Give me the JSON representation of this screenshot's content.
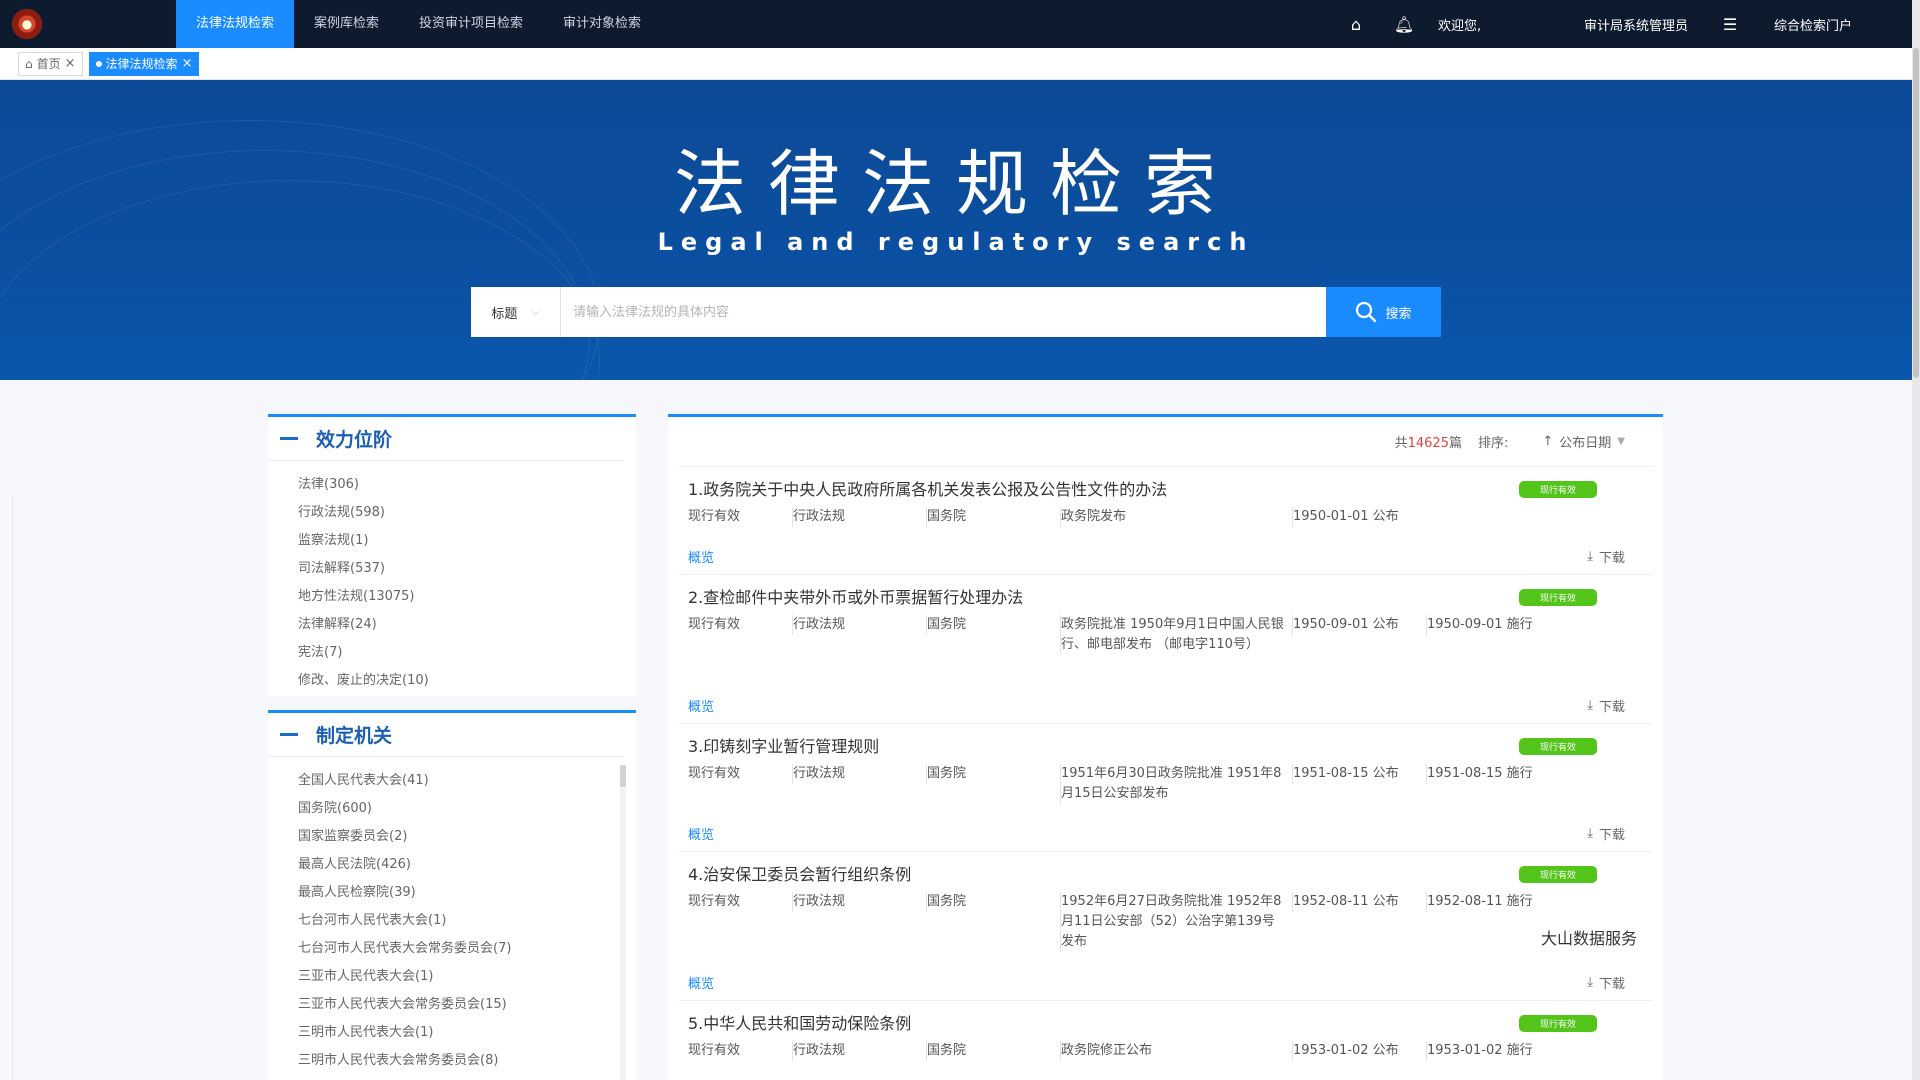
{
  "topbar": {
    "nav": [
      "法律法规检索",
      "案例库检索",
      "投资审计项目检索",
      "审计对象检索"
    ],
    "welcome": "欢迎您,",
    "user": "审计局系统管理员",
    "portal": "综合检索门户"
  },
  "tags": {
    "home": "首页",
    "current": "法律法规检索"
  },
  "banner": {
    "title": "法律法规检索",
    "subtitle": "Legal and regulatory search"
  },
  "search": {
    "field": "标题",
    "placeholder": "请输入法律法规的具体内容",
    "button": "搜索"
  },
  "panel_level": {
    "title": "效力位阶",
    "items": [
      "法律(306)",
      "行政法规(598)",
      "监察法规(1)",
      "司法解释(537)",
      "地方性法规(13075)",
      "法律解释(24)",
      "宪法(7)",
      "修改、废止的决定(10)"
    ]
  },
  "panel_org": {
    "title": "制定机关",
    "items": [
      "全国人民代表大会(41)",
      "国务院(600)",
      "国家监察委员会(2)",
      "最高人民法院(426)",
      "最高人民检察院(39)",
      "七台河市人民代表大会(1)",
      "七台河市人民代表大会常务委员会(7)",
      "三亚市人民代表大会(1)",
      "三亚市人民代表大会常务委员会(15)",
      "三明市人民代表大会(1)",
      "三明市人民代表大会常务委员会(8)"
    ]
  },
  "results": {
    "total_prefix": "共",
    "total": "14625",
    "total_suffix": "篇",
    "sort_label": "排序:",
    "sort_value": "公布日期",
    "overview": "概览",
    "download": "下载",
    "watermark": "大山数据服务",
    "items": [
      {
        "title": "1.政务院关于中央人民政府所属各机关发表公报及公告性文件的办法",
        "badge": "现行有效",
        "status": "现行有效",
        "level": "行政法规",
        "org": "国务院",
        "note": "政务院发布",
        "published": "1950-01-01 公布",
        "effective": ""
      },
      {
        "title": "2.查检邮件中夹带外币或外币票据暂行处理办法",
        "badge": "现行有效",
        "status": "现行有效",
        "level": "行政法规",
        "org": "国务院",
        "note": "政务院批准 1950年9月1日中国人民银行、邮电部发布 （邮电字110号）",
        "published": "1950-09-01 公布",
        "effective": "1950-09-01 施行"
      },
      {
        "title": "3.印铸刻字业暂行管理规则",
        "badge": "现行有效",
        "status": "现行有效",
        "level": "行政法规",
        "org": "国务院",
        "note": "1951年6月30日政务院批准 1951年8月15日公安部发布",
        "published": "1951-08-15 公布",
        "effective": "1951-08-15 施行"
      },
      {
        "title": "4.治安保卫委员会暂行组织条例",
        "badge": "现行有效",
        "status": "现行有效",
        "level": "行政法规",
        "org": "国务院",
        "note": "1952年6月27日政务院批准 1952年8月11日公安部（52）公治字第139号发布",
        "published": "1952-08-11 公布",
        "effective": "1952-08-11 施行"
      },
      {
        "title": "5.中华人民共和国劳动保险条例",
        "badge": "现行有效",
        "status": "现行有效",
        "level": "行政法规",
        "org": "国务院",
        "note": "政务院修正公布",
        "published": "1953-01-02 公布",
        "effective": "1953-01-02 施行"
      }
    ]
  }
}
